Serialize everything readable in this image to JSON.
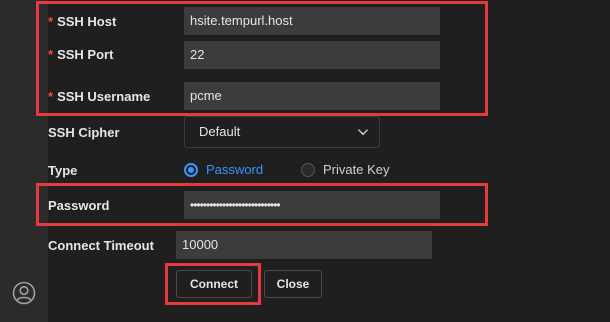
{
  "form": {
    "ssh_host": {
      "required_mark": "*",
      "label": "SSH Host",
      "value": "hsite.tempurl.host"
    },
    "ssh_port": {
      "required_mark": "*",
      "label": "SSH Port",
      "value": "22"
    },
    "ssh_username": {
      "required_mark": "*",
      "label": "SSH Username",
      "value": "pcme"
    },
    "ssh_cipher": {
      "label": "SSH Cipher",
      "selected": "Default"
    },
    "type": {
      "label": "Type",
      "options": [
        {
          "label": "Password",
          "checked": true
        },
        {
          "label": "Private Key",
          "checked": false
        }
      ]
    },
    "password": {
      "label": "Password",
      "value": "••••••••••••••••••••••••••••"
    },
    "connect_timeout": {
      "label": "Connect Timeout",
      "value": "10000"
    }
  },
  "buttons": {
    "connect": "Connect",
    "close": "Close"
  },
  "colors": {
    "accent": "#3794ff",
    "required": "#f14c4c",
    "highlight": "#e63a3f"
  },
  "icons": {
    "account": "account-icon",
    "dropdown": "chevron-down-icon"
  }
}
